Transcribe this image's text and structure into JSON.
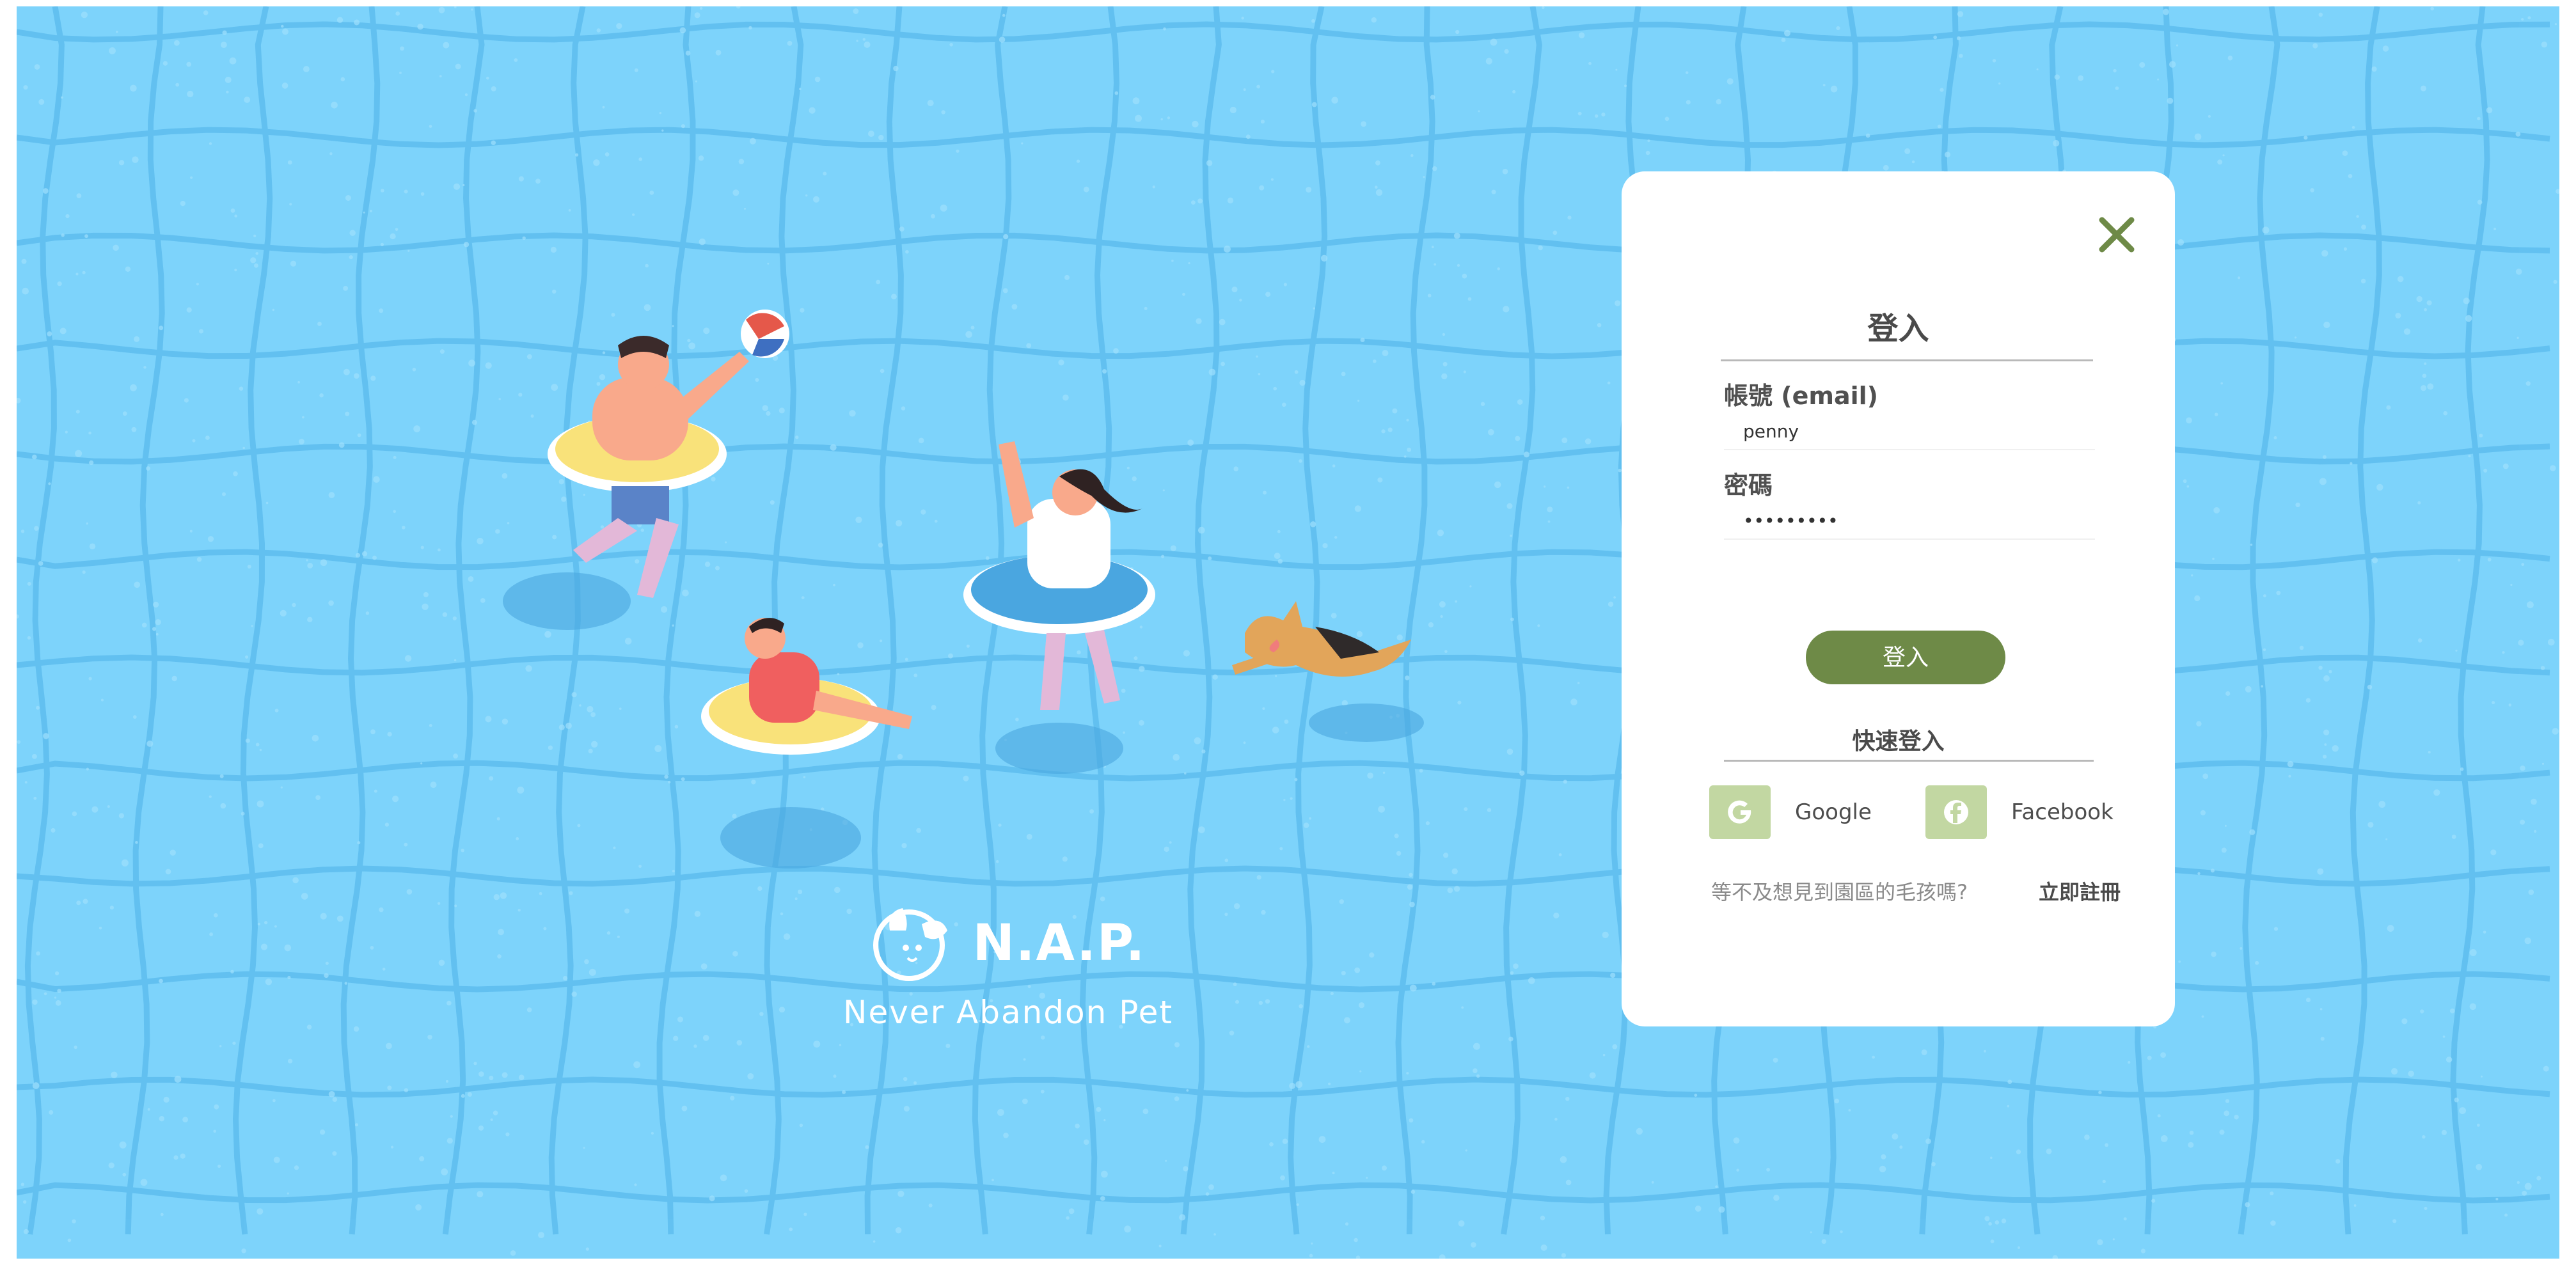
{
  "brand": {
    "name": "N.A.P.",
    "tagline": "Never Abandon Pet",
    "logo_icon": "dog-face-logo-icon"
  },
  "login": {
    "title": "登入",
    "close_icon": "close-icon",
    "account_label": "帳號 (email)",
    "account_value": "penny",
    "password_label": "密碼",
    "password_value": "pennypass",
    "submit_label": "登入",
    "quick_login_title": "快速登入",
    "social": [
      {
        "label": "Google",
        "icon": "google-icon"
      },
      {
        "label": "Facebook",
        "icon": "facebook-icon"
      }
    ],
    "signup_prompt": "等不及想見到園區的毛孩嗎?",
    "signup_link": "立即註冊"
  },
  "colors": {
    "pool": "#7dd3fb",
    "accent": "#6e8a47",
    "social_icon_bg": "#c2d7a2",
    "close": "#6e8a47"
  }
}
